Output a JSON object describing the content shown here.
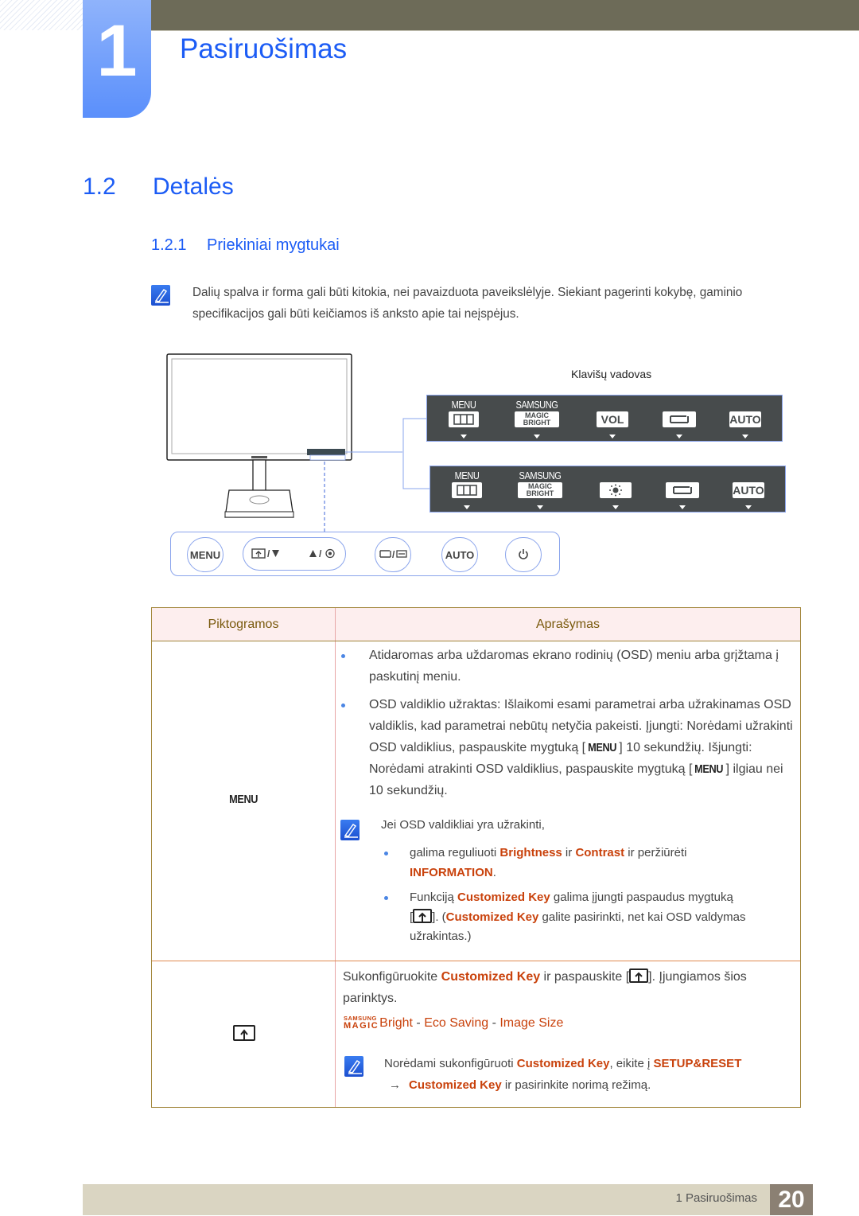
{
  "chapter": {
    "number": "1",
    "title": "Pasiruošimas"
  },
  "section": {
    "number": "1.2",
    "title": "Detalės"
  },
  "subsection": {
    "number": "1.2.1",
    "title": "Priekiniai mygtukai"
  },
  "note_top": "Dalių spalva ir forma gali būti kitokia, nei pavaizduota paveikslėlyje. Siekiant pagerinti kokybę, gaminio specifikacijos gali būti keičiamos iš anksto apie tai neįspėjus.",
  "diagram": {
    "key_guide_label": "Klavišų vadovas",
    "osd1": [
      {
        "label": "MENU",
        "key": "menu-icon"
      },
      {
        "label": "SAMSUNG",
        "key_top": "MAGIC",
        "key_bottom": "BRIGHT"
      },
      {
        "label": "",
        "key": "VOL"
      },
      {
        "label": "",
        "key": "source-swap-icon"
      },
      {
        "label": "",
        "key": "AUTO"
      }
    ],
    "osd2": [
      {
        "label": "MENU",
        "key": "menu-icon"
      },
      {
        "label": "SAMSUNG",
        "key_top": "MAGIC",
        "key_bottom": "BRIGHT"
      },
      {
        "label": "",
        "key": "brightness-icon"
      },
      {
        "label": "",
        "key": "source-swap-icon"
      },
      {
        "label": "",
        "key": "AUTO"
      }
    ],
    "buttons": {
      "menu": "MENU",
      "slash1": "/",
      "slash2": "/",
      "slash3": "/",
      "auto": "AUTO"
    }
  },
  "table": {
    "headers": [
      "Piktogramos",
      "Aprašymas"
    ],
    "row1": {
      "icon_label": "MENU",
      "bullet1": "Atidaromas arba uždaromas ekrano rodinių (OSD) meniu arba grįžtama į paskutinį meniu.",
      "bullet2_a": "OSD valdiklio užraktas: Išlaikomi esami parametrai arba užrakinamas OSD valdiklis, kad parametrai nebūtų netyčia pakeisti. Įjungti: Norėdami užrakinti OSD valdiklius, paspauskite mygtuką [",
      "bullet2_menu1": "MENU",
      "bullet2_b": "] 10 sekundžių. Išjungti: Norėdami atrakinti OSD valdiklius, paspauskite mygtuką [",
      "bullet2_menu2": "MENU",
      "bullet2_c": "] ilgiau nei 10 sekundžių.",
      "note_intro": "Jei OSD valdikliai yra užrakinti,",
      "sub1_a": "galima reguliuoti ",
      "sub1_brightness": "Brightness",
      "sub1_b": " ir ",
      "sub1_contrast": "Contrast",
      "sub1_c": " ir peržiūrėti",
      "sub1_information": "INFORMATION",
      "sub1_d": ".",
      "sub2_a": "Funkciją ",
      "sub2_ck": "Customized Key",
      "sub2_b": " galima įjungti paspaudus mygtuką",
      "sub2_c": "[",
      "sub2_d": "]. (",
      "sub2_ck2": "Customized Key",
      "sub2_e": " galite pasirinkti, net kai OSD valdymas",
      "sub2_f": "užrakintas.)"
    },
    "row2": {
      "line1_a": "Sukonfigūruokite ",
      "line1_ck": "Customized Key",
      "line1_b": " ir paspauskite [",
      "line1_c": "]. Įjungiamos šios",
      "line2": "parinktys.",
      "magic_top": "SAMSUNG",
      "magic_bottom": "MAGIC",
      "opt_bright": "Bright",
      "sep1": " - ",
      "opt_eco": "Eco Saving",
      "sep2": " - ",
      "opt_size": "Image Size",
      "note_a": "Norėdami sukonfigūruoti ",
      "note_ck": "Customized Key",
      "note_b": ", eikite į ",
      "note_setup": "SETUP&RESET",
      "note_arrow": "→",
      "note_ck2": "Customized Key",
      "note_c": " ir pasirinkite norimą režimą."
    }
  },
  "footer": {
    "chapter_label": "1 Pasiruošimas",
    "page": "20"
  }
}
